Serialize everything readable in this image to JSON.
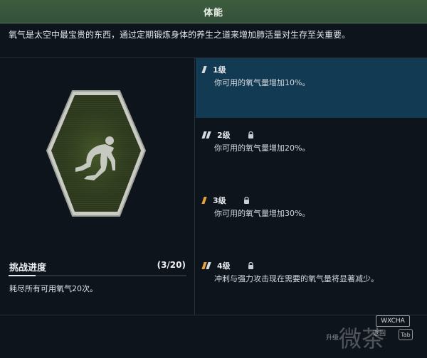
{
  "title": "体能",
  "description": "氧气是太空中最宝贵的东西，通过定期锻炼身体的养生之道来增加肺活量对生存至关重要。",
  "challenge": {
    "title": "挑战进度",
    "count": "(3/20)",
    "progress": 0.15,
    "description": "耗尽所有可用氧气20次。"
  },
  "levels": [
    {
      "name": "1级",
      "description": "你可用的氧气量增加10%。",
      "locked": false,
      "active": true
    },
    {
      "name": "2级",
      "description": "你可用的氧气量增加20%。",
      "locked": true,
      "active": false
    },
    {
      "name": "3级",
      "description": "你可用的氧气量增加30%。",
      "locked": true,
      "active": false
    },
    {
      "name": "4级",
      "description": "冲刺与强力攻击现在需要的氧气量将显著减少。",
      "locked": true,
      "active": false
    }
  ],
  "footer": {
    "watermark": "微茶",
    "watermark_badge": "WXCHA",
    "back_hint": "返回",
    "upgrade_hint": "升级",
    "key_label": "Tab"
  },
  "colors": {
    "title_bar": "#3d5d3e",
    "active_level": "#123a52",
    "badge_fill": "#2e3a1e",
    "accent_tick": "#e7a23a"
  },
  "icons": {
    "badge_figure": "kneeling-runner-icon",
    "lock": "lock-icon"
  }
}
